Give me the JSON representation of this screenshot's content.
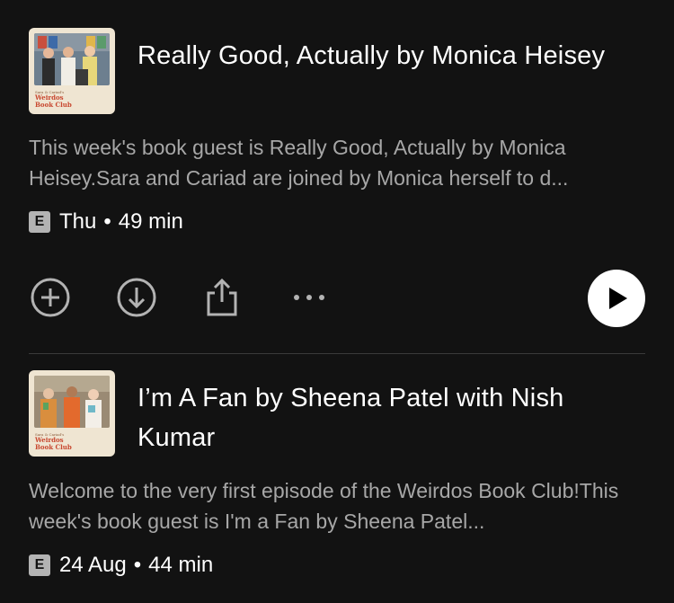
{
  "episodes": [
    {
      "title": "Really Good, Actually by Monica Heisey",
      "description": "This week's book guest is Really Good, Actually by Monica Heisey.Sara and Cariad are joined by Monica herself to d...",
      "explicit_badge": "E",
      "date": "Thu",
      "separator": "•",
      "duration": "49 min",
      "artwork": {
        "brand_small": "Sara & Cariad's",
        "brand_line1": "Weirdos",
        "brand_line2": "Book Club"
      }
    },
    {
      "title": "I’m A Fan by Sheena Patel with Nish Kumar",
      "description": "Welcome to the very first episode of the Weirdos Book Club!This week's book guest is I'm a Fan by Sheena Patel...",
      "explicit_badge": "E",
      "date": "24 Aug",
      "separator": "•",
      "duration": "44 min",
      "artwork": {
        "brand_small": "Sara & Cariad's",
        "brand_line1": "Weirdos",
        "brand_line2": "Book Club"
      }
    }
  ],
  "icons": {
    "add": "plus-circle-icon",
    "download": "download-circle-icon",
    "share": "share-icon",
    "more": "more-dots-icon",
    "play": "play-icon"
  },
  "colors": {
    "background": "#121212",
    "title": "#ffffff",
    "description": "#a7a7a7",
    "badge": "#b3b3b3",
    "play_button": "#ffffff"
  }
}
